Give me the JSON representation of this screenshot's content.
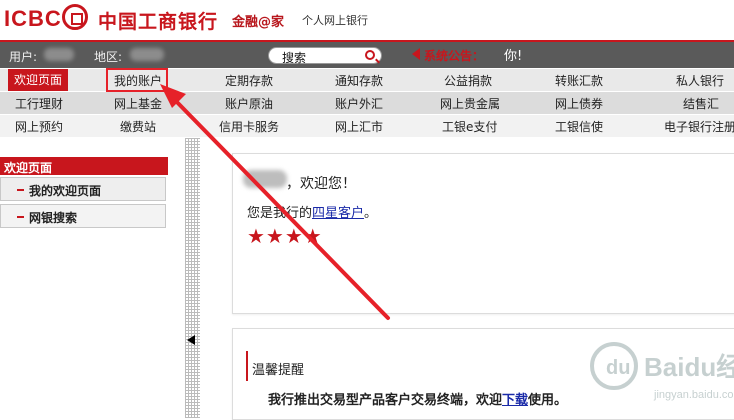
{
  "header": {
    "logo_text": "ICBC",
    "bank_name": "中国工商银行",
    "slogan": "金融@家",
    "subtitle": "个人网上银行"
  },
  "infobar": {
    "user_label": "用户:",
    "region_label": "地区:",
    "search_label": "搜索",
    "notice_label": "系统公告：",
    "notice_text": "你!"
  },
  "nav": {
    "row1": [
      "欢迎页面",
      "我的账户",
      "定期存款",
      "通知存款",
      "公益捐款",
      "转账汇款",
      "私人银行"
    ],
    "row2": [
      "工行理财",
      "网上基金",
      "账户原油",
      "账户外汇",
      "网上贵金属",
      "网上债券",
      "结售汇"
    ],
    "row3": [
      "网上预约",
      "缴费站",
      "信用卡服务",
      "网上汇市",
      "工银e支付",
      "工银信使",
      "电子银行注册"
    ],
    "active": "欢迎页面"
  },
  "sidebar": {
    "title": "欢迎页面",
    "items": [
      {
        "label": "我的欢迎页面"
      },
      {
        "label": "网银搜索"
      }
    ]
  },
  "welcome": {
    "greeting": "，欢迎您！",
    "level_prefix": "您是我行的",
    "level_link": "四星客户",
    "level_suffix": "。",
    "stars": "★★★★",
    "star_count": 4
  },
  "tips": {
    "title": "温馨提醒",
    "body_prefix": "我行推出交易型产品客户交易终端，欢迎",
    "body_link": "下载",
    "body_suffix": "使用。"
  },
  "watermark": {
    "text": "Baidu经验",
    "sub": "jingyan.baidu.com"
  },
  "colors": {
    "brand_red": "#c8161d",
    "annotation_red": "#e62129",
    "link_blue": "#1a2aa8"
  }
}
